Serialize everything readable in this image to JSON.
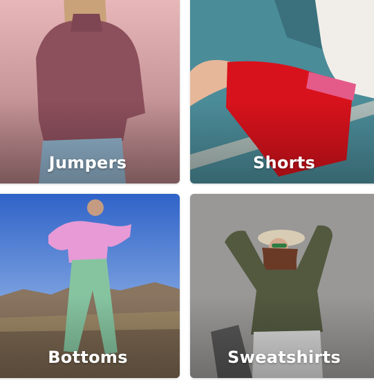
{
  "categories": [
    {
      "label": "Jumpers",
      "image": "woman-pink-jumper-photo"
    },
    {
      "label": "Shorts",
      "image": "red-shorts-photo"
    },
    {
      "label": "Bottoms",
      "image": "green-trousers-photo"
    },
    {
      "label": "Sweatshirts",
      "image": "olive-sweatshirt-photo"
    }
  ]
}
